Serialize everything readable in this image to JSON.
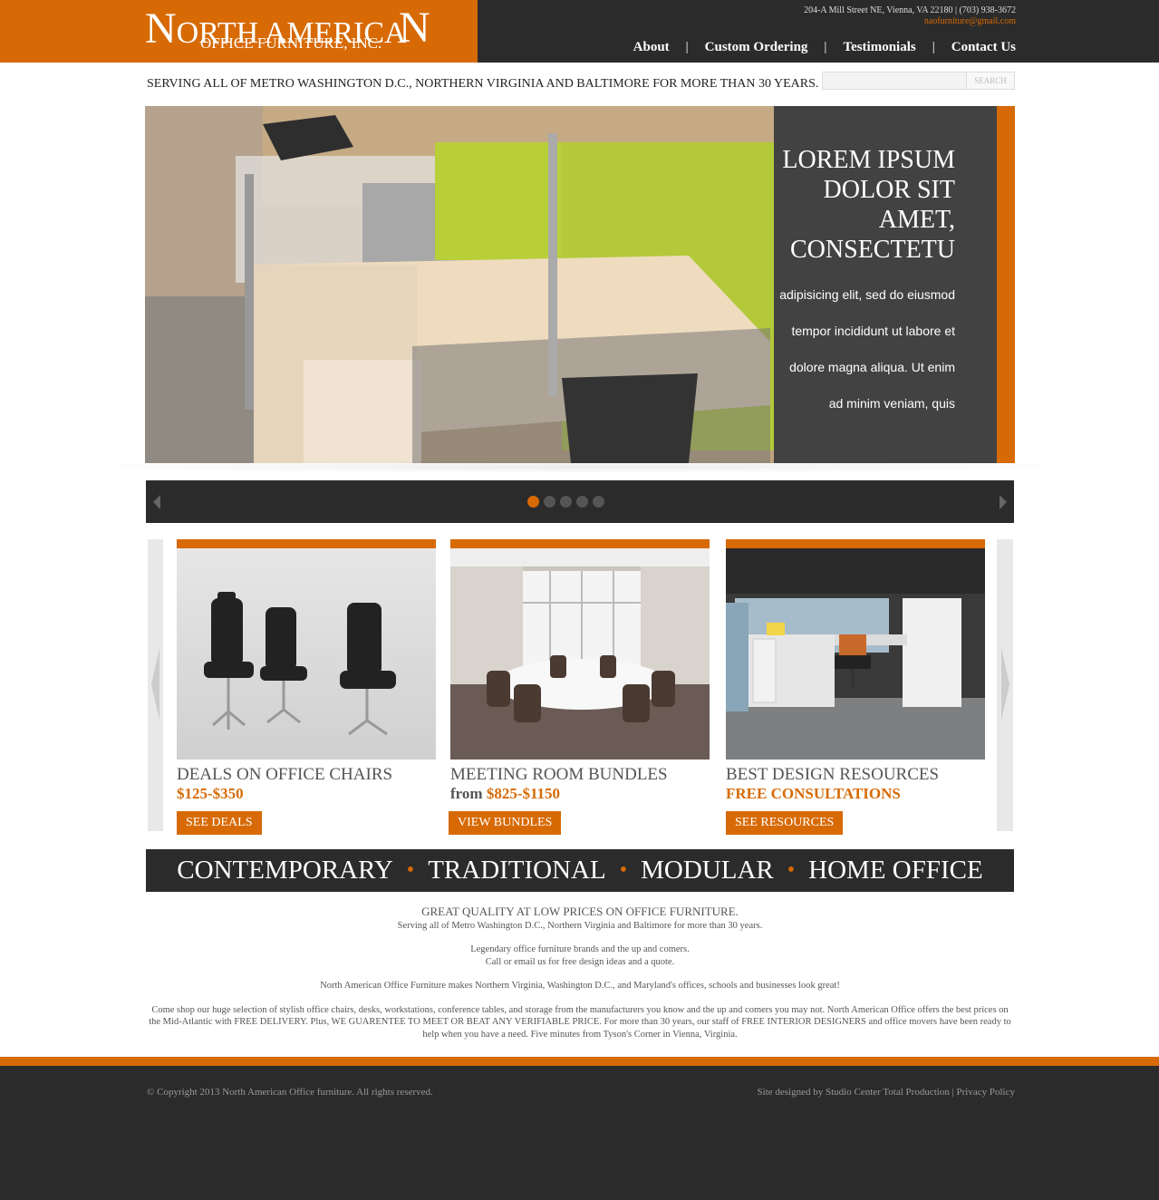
{
  "header": {
    "logo_line1_a": "N",
    "logo_line1_b": "ORTH AMERICA",
    "logo_line1_c": "N",
    "logo_line2": "OFFICE FURNITURE, INC.",
    "address": "204-A Mill Street NE, Vienna, VA 22180  |  (703) 938-3672",
    "email": "naofurniture@gmail.com",
    "nav": [
      {
        "label": "About"
      },
      {
        "label": "Custom Ordering"
      },
      {
        "label": "Testimonials"
      },
      {
        "label": "Contact Us"
      }
    ],
    "nav_separator": "|"
  },
  "tagline": "SERVING ALL OF METRO WASHINGTON D.C., NORTHERN VIRGINIA AND BALTIMORE FOR MORE THAN 30 YEARS.",
  "search": {
    "value": "",
    "button_label": "SEARCH"
  },
  "hero": {
    "title": "LOREM IPSUM DOLOR SIT AMET, CONSECTETU",
    "text_lines": [
      "adipisicing elit, sed do eiusmod",
      "tempor incididunt ut labore et",
      "dolore magna aliqua. Ut enim",
      "ad minim veniam, quis"
    ]
  },
  "slider": {
    "dots": 5,
    "active_dot": 1
  },
  "cards": [
    {
      "title": "DEALS ON OFFICE CHAIRS",
      "price_prefix": "",
      "price": "$125-$350",
      "button": "SEE DEALS"
    },
    {
      "title": "MEETING ROOM BUNDLES",
      "price_prefix": "from ",
      "price": "$825-$1150",
      "button": "VIEW BUNDLES"
    },
    {
      "title": "BEST DESIGN RESOURCES",
      "price_prefix": "",
      "price": "FREE CONSULTATIONS",
      "button": "SEE RESOURCES"
    }
  ],
  "styles": [
    "CONTEMPORARY",
    "TRADITIONAL",
    "MODULAR",
    "HOME OFFICE"
  ],
  "style_bullet": "•",
  "copy": {
    "heading": "GREAT QUALITY AT LOW PRICES ON OFFICE FURNITURE.",
    "line1": "Serving all of Metro Washington D.C., Northern Virginia and Baltimore for more than 30 years.",
    "line2": "Legendary office furniture brands and the up and comers.",
    "line3": "Call or email us for free design ideas and a quote.",
    "line4": "North American Office Furniture makes Northern Virginia, Washington D.C., and Maryland's offices, schools and businesses look great!",
    "line5": "Come shop our huge selection of stylish office chairs, desks, workstations, conference tables, and storage from the manufacturers you know and the up and comers you may not.  North American Office offers the best prices on the Mid-Atlantic with FREE DELIVERY.  Plus, WE GUARENTEE TO MEET OR BEAT ANY VERIFIABLE PRICE.  For more than 30 years, our staff of FREE INTERIOR DESIGNERS and office movers have been ready to help when you have a need.  Five minutes from Tyson's Corner in Vienna, Virginia."
  },
  "footer": {
    "copyright": "© Copyright 2013 North American Office furniture. All rights reserved.",
    "designed_by": "Site designed by Studio Center Total Production",
    "separator": " | ",
    "privacy": "Privacy Policy"
  },
  "colors": {
    "accent": "#d76a05",
    "dark": "#2b2b2b"
  }
}
